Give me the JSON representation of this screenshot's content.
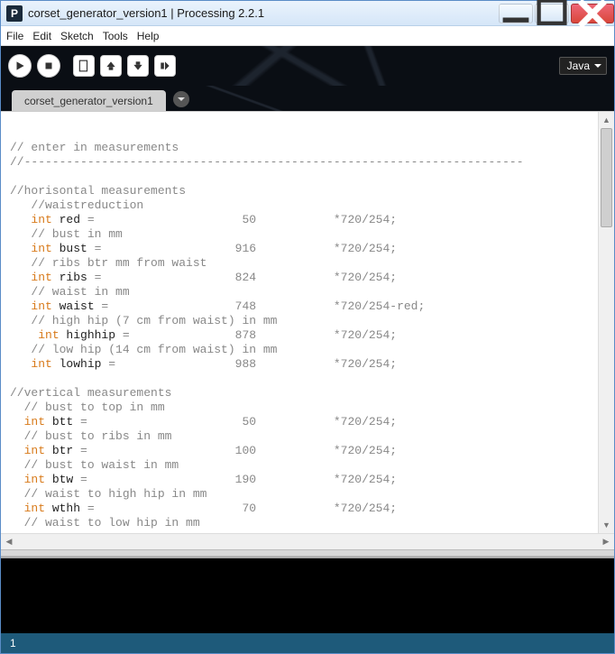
{
  "window": {
    "app_letter": "P",
    "title": "corset_generator_version1 | Processing 2.2.1"
  },
  "menu": {
    "file": "File",
    "edit": "Edit",
    "sketch": "Sketch",
    "tools": "Tools",
    "help": "Help"
  },
  "toolbar": {
    "mode": "Java"
  },
  "tab": {
    "name": "corset_generator_version1"
  },
  "code": {
    "lines": [
      {
        "pre": "",
        "kw": "",
        "ident": "",
        "post": ""
      },
      {
        "pre": "// enter in measurements",
        "kw": "",
        "ident": "",
        "post": ""
      },
      {
        "pre": "//-----------------------------------------------------------------------",
        "kw": "",
        "ident": "",
        "post": ""
      },
      {
        "pre": "",
        "kw": "",
        "ident": "",
        "post": ""
      },
      {
        "pre": "//horisontal measurements",
        "kw": "",
        "ident": "",
        "post": ""
      },
      {
        "pre": "   //waistreduction",
        "kw": "",
        "ident": "",
        "post": ""
      },
      {
        "pre": "   ",
        "kw": "int",
        "ident": " red",
        "post": " =                     50           *720/254;"
      },
      {
        "pre": "   // bust in mm",
        "kw": "",
        "ident": "",
        "post": ""
      },
      {
        "pre": "   ",
        "kw": "int",
        "ident": " bust",
        "post": " =                   916           *720/254;"
      },
      {
        "pre": "   // ribs btr mm from waist",
        "kw": "",
        "ident": "",
        "post": ""
      },
      {
        "pre": "   ",
        "kw": "int",
        "ident": " ribs",
        "post": " =                   824           *720/254;"
      },
      {
        "pre": "   // waist in mm",
        "kw": "",
        "ident": "",
        "post": ""
      },
      {
        "pre": "   ",
        "kw": "int",
        "ident": " waist",
        "post": " =                  748           *720/254-red;"
      },
      {
        "pre": "   // high hip (7 cm from waist) in mm",
        "kw": "",
        "ident": "",
        "post": ""
      },
      {
        "pre": "    ",
        "kw": "int",
        "ident": " highhip",
        "post": " =               878           *720/254;"
      },
      {
        "pre": "   // low hip (14 cm from waist) in mm",
        "kw": "",
        "ident": "",
        "post": ""
      },
      {
        "pre": "   ",
        "kw": "int",
        "ident": " lowhip",
        "post": " =                 988           *720/254;"
      },
      {
        "pre": "",
        "kw": "",
        "ident": "",
        "post": ""
      },
      {
        "pre": "//vertical measurements",
        "kw": "",
        "ident": "",
        "post": ""
      },
      {
        "pre": "  // bust to top in mm",
        "kw": "",
        "ident": "",
        "post": ""
      },
      {
        "pre": "  ",
        "kw": "int",
        "ident": " btt",
        "post": " =                      50           *720/254;"
      },
      {
        "pre": "  // bust to ribs in mm",
        "kw": "",
        "ident": "",
        "post": ""
      },
      {
        "pre": "  ",
        "kw": "int",
        "ident": " btr",
        "post": " =                     100           *720/254;"
      },
      {
        "pre": "  // bust to waist in mm",
        "kw": "",
        "ident": "",
        "post": ""
      },
      {
        "pre": "  ",
        "kw": "int",
        "ident": " btw",
        "post": " =                     190           *720/254;"
      },
      {
        "pre": "  // waist to high hip in mm",
        "kw": "",
        "ident": "",
        "post": ""
      },
      {
        "pre": "  ",
        "kw": "int",
        "ident": " wthh",
        "post": " =                     70           *720/254;"
      },
      {
        "pre": "  // waist to low hip in mm",
        "kw": "",
        "ident": "",
        "post": ""
      }
    ]
  },
  "status": {
    "line": "1"
  }
}
